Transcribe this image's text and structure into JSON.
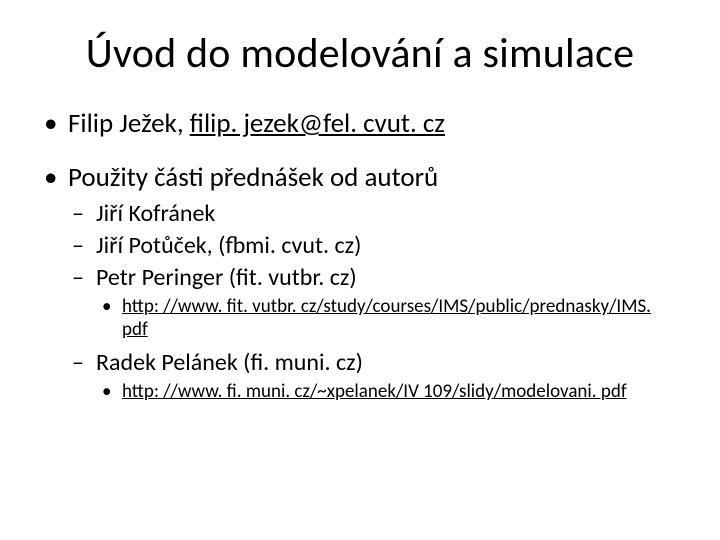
{
  "title": "Úvod do modelování a simulace",
  "bullets": {
    "author_prefix": "Filip Ježek, ",
    "author_email": "filip. jezek@fel. cvut. cz",
    "credits_heading": "Použity části přednášek od autorů",
    "credits": {
      "a1": "Jiří Kofránek",
      "a2": "Jiří Potůček, (fbmi. cvut. cz)",
      "a3": "Petr Peringer (fit. vutbr. cz)",
      "a3_link": "http: //www. fit. vutbr. cz/study/courses/IMS/public/prednasky/IMS. pdf",
      "a4": "Radek Pelánek (fi. muni. cz)",
      "a4_link": "http: //www. fi. muni. cz/~xpelanek/IV 109/slidy/modelovani. pdf"
    }
  }
}
